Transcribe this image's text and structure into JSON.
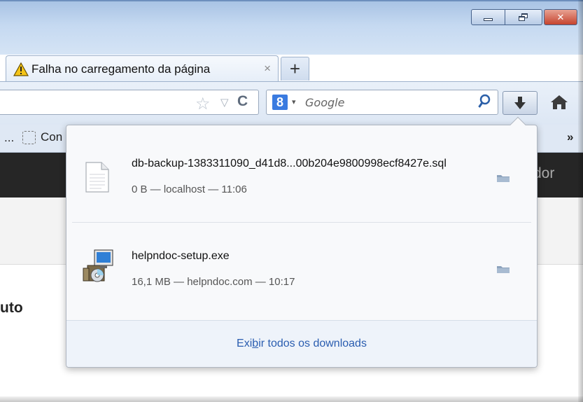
{
  "tab": {
    "title": "Falha no carregamento da página",
    "close_glyph": "×",
    "new_tab_glyph": "+"
  },
  "window_controls": {
    "close_glyph": "✕"
  },
  "navbar": {
    "star_glyph": "☆",
    "dropmarker_glyph": "▽",
    "reload_glyph": "C",
    "search_engine_letter": "8",
    "search_engine_drop": "▾",
    "search_placeholder": "Google"
  },
  "bookmarks": {
    "ellipsis": "...",
    "item_label": "Con",
    "chevron": "»"
  },
  "page": {
    "dark_bar_text": "dor",
    "heading_fragment": "uto"
  },
  "downloads": {
    "items": [
      {
        "name": "db-backup-1383311090_d41d8...00b204e9800998ecf8427e.sql",
        "meta": "0 B — localhost — 11:06",
        "icon": "document-icon"
      },
      {
        "name": "helpndoc-setup.exe",
        "meta": "16,1 MB — helpndoc.com — 10:17",
        "icon": "installer-icon"
      }
    ],
    "show_all_pre": "Exi",
    "show_all_accesskey": "b",
    "show_all_post": "ir todos os downloads"
  },
  "colors": {
    "link": "#2a5db0",
    "titlebar": "#c5d9f1",
    "close_button": "#c5432e",
    "dark_bar": "#262626"
  }
}
